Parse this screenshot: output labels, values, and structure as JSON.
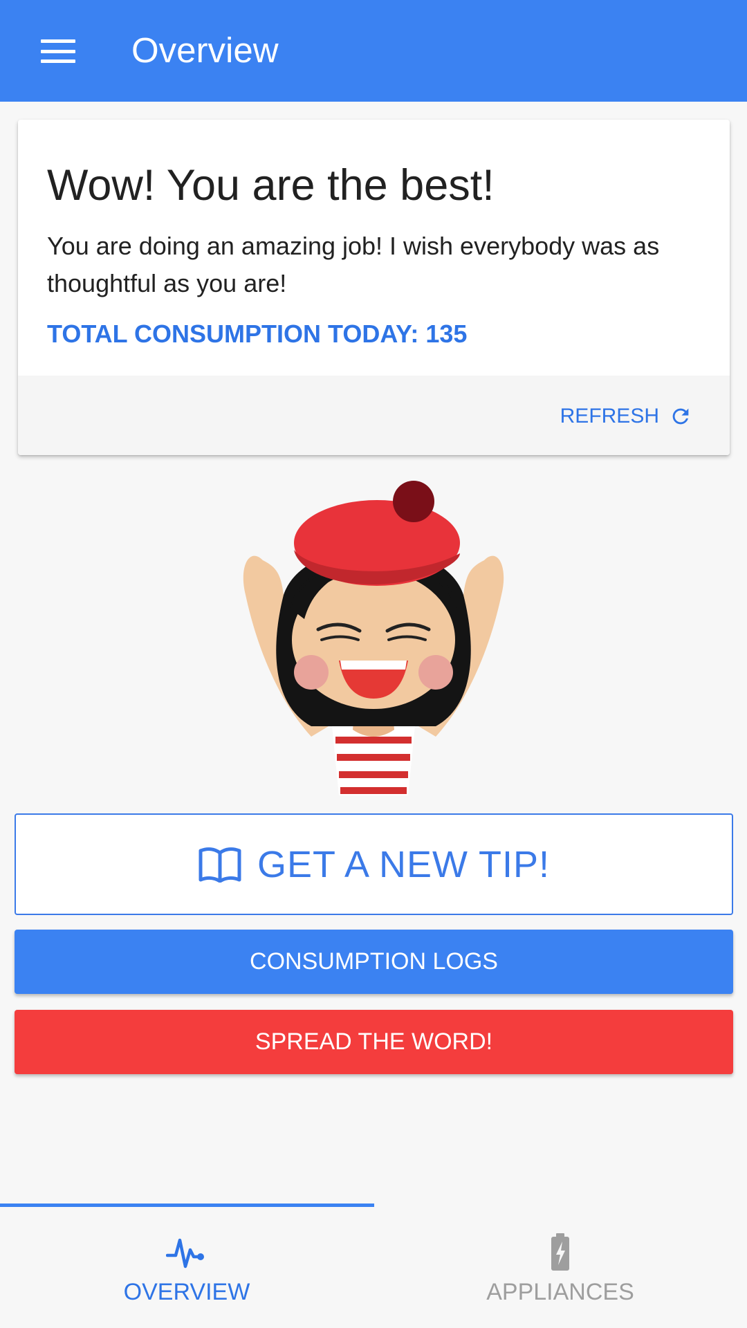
{
  "appbar": {
    "title": "Overview",
    "menu_icon": "hamburger-menu-icon",
    "color": "#3b82f2"
  },
  "card": {
    "title": "Wow! You are the best!",
    "message": "You are doing an amazing job! I wish everybody was as thoughtful as you are!",
    "total": "TOTAL CONSUMPTION TODAY: 135",
    "refresh_label": "REFRESH",
    "refresh_icon": "refresh-icon"
  },
  "illustration": {
    "name": "cheering-girl-mascot"
  },
  "buttons": {
    "tip_label": "GET A NEW TIP!",
    "tip_icon": "book-icon",
    "logs_label": "CONSUMPTION LOGS",
    "spread_label": "SPREAD THE WORD!"
  },
  "colors": {
    "primary": "#3b82f2",
    "accent_red": "#f43d3d",
    "text_blue": "#2e74e6"
  },
  "bottom_nav": {
    "tabs": [
      {
        "label": "OVERVIEW",
        "icon": "pulse-icon",
        "active": true
      },
      {
        "label": "APPLIANCES",
        "icon": "battery-charging-icon",
        "active": false
      }
    ]
  }
}
